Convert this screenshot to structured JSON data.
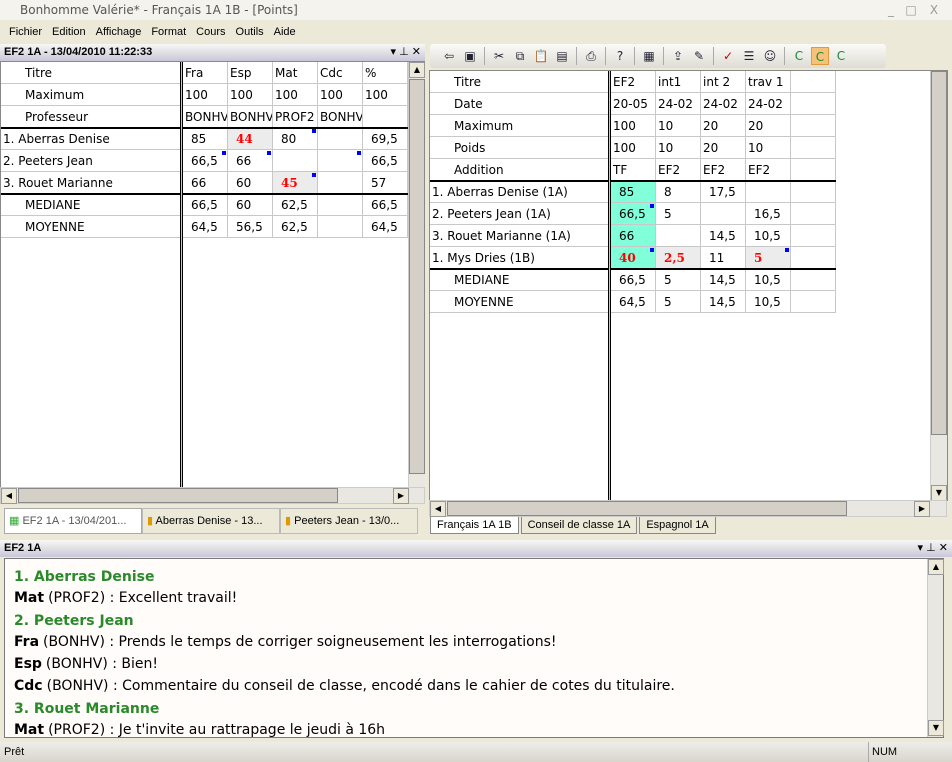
{
  "window": {
    "title": "Bonhomme Valérie* - Français 1A 1B - [Points]",
    "minimize": "_",
    "maximize": "□",
    "close": "X"
  },
  "menu": [
    "Fichier",
    "Edition",
    "Affichage",
    "Format",
    "Cours",
    "Outils",
    "Aide"
  ],
  "left_pane": {
    "title": "EF2 1A  - 13/04/2010 11:22:33",
    "header_rows": [
      "Titre",
      "Maximum",
      "Professeur"
    ],
    "student_rows": [
      "1. Aberras Denise",
      "2. Peeters Jean",
      "3. Rouet Marianne"
    ],
    "stat_rows": [
      "MEDIANE",
      "MOYENNE"
    ],
    "columns": [
      {
        "cells": [
          "Fra",
          "100",
          "BONHV"
        ],
        "students": [
          {
            "v": "85"
          },
          {
            "v": "66,5",
            "note": true
          },
          {
            "v": "66"
          }
        ],
        "stats": [
          "66,5",
          "64,5"
        ]
      },
      {
        "cells": [
          "Esp",
          "100",
          "BONHV"
        ],
        "students": [
          {
            "v": "44",
            "flag": true
          },
          {
            "v": "66",
            "note": true
          },
          {
            "v": "60"
          }
        ],
        "stats": [
          "60",
          "56,5"
        ]
      },
      {
        "cells": [
          "Mat",
          "100",
          "PROF2"
        ],
        "students": [
          {
            "v": "80",
            "note": true
          },
          {
            "v": ""
          },
          {
            "v": "45",
            "flag": true,
            "note": true
          }
        ],
        "stats": [
          "62,5",
          "62,5"
        ]
      },
      {
        "cells": [
          "Cdc",
          "100",
          "BONHV"
        ],
        "students": [
          {
            "v": ""
          },
          {
            "v": "",
            "note": true
          },
          {
            "v": ""
          }
        ],
        "stats": [
          "",
          ""
        ]
      },
      {
        "cells": [
          "%",
          "100",
          ""
        ],
        "students": [
          {
            "v": "69,5"
          },
          {
            "v": "66,5"
          },
          {
            "v": "57"
          }
        ],
        "stats": [
          "66,5",
          "64,5"
        ]
      }
    ],
    "tabs": [
      "EF2 1A  - 13/04/201...",
      "Aberras Denise   - 13...",
      "Peeters Jean   - 13/0..."
    ]
  },
  "right_pane": {
    "toolbar": [
      "exit-icon",
      "save-icon",
      "cut-icon",
      "copy-icon",
      "paste-icon",
      "paste-special-icon",
      "print-icon",
      "help-icon",
      "calendar-icon",
      "export-icon",
      "brush-icon",
      "check-icon",
      "list-icon",
      "student-icon",
      "column-c-icon",
      "column-c-selected-icon",
      "column-c-alt-icon"
    ],
    "header_rows": [
      "Titre",
      "Date",
      "Maximum",
      "Poids",
      "Addition"
    ],
    "student_rows": [
      "1. Aberras Denise (1A)",
      "2. Peeters Jean (1A)",
      "3. Rouet Marianne (1A)",
      "1. Mys Dries (1B)"
    ],
    "stat_rows": [
      "MEDIANE",
      "MOYENNE"
    ],
    "columns": [
      {
        "cells": [
          "EF2",
          "20-05",
          "100",
          "100",
          "TF"
        ],
        "students": [
          {
            "v": "85",
            "cyan": true
          },
          {
            "v": "66,5",
            "cyan": true,
            "note": true
          },
          {
            "v": "66",
            "cyan": true
          },
          {
            "v": "40",
            "cyan": true,
            "flag": true,
            "note": true
          }
        ],
        "stats": [
          "66,5",
          "64,5"
        ]
      },
      {
        "cells": [
          "int1",
          "24-02",
          "10",
          "10",
          "EF2"
        ],
        "students": [
          {
            "v": "8"
          },
          {
            "v": "5"
          },
          {
            "v": ""
          },
          {
            "v": "2,5",
            "flag": true
          }
        ],
        "stats": [
          "5",
          "5"
        ]
      },
      {
        "cells": [
          "int 2",
          "24-02",
          "20",
          "20",
          "EF2"
        ],
        "students": [
          {
            "v": "17,5"
          },
          {
            "v": ""
          },
          {
            "v": "14,5"
          },
          {
            "v": "11"
          }
        ],
        "stats": [
          "14,5",
          "14,5"
        ]
      },
      {
        "cells": [
          "trav 1",
          "24-02",
          "20",
          "10",
          "EF2"
        ],
        "students": [
          {
            "v": ""
          },
          {
            "v": "16,5"
          },
          {
            "v": "10,5"
          },
          {
            "v": "5",
            "flag": true,
            "note": true
          }
        ],
        "stats": [
          "10,5",
          "10,5"
        ]
      },
      {
        "cells": [
          "",
          "",
          "",
          "",
          ""
        ],
        "students": [
          {
            "v": ""
          },
          {
            "v": ""
          },
          {
            "v": ""
          },
          {
            "v": ""
          }
        ],
        "stats": [
          "",
          ""
        ]
      }
    ],
    "tabs": [
      "Français 1A 1B",
      "Conseil de classe 1A",
      "Espagnol 1A"
    ]
  },
  "comments_pane": {
    "title": "EF2 1A",
    "groups": [
      {
        "student": "1. Aberras Denise",
        "lines": [
          {
            "course": "Mat",
            "prof": "(PROF2)",
            "text": " : Excellent travail!"
          }
        ]
      },
      {
        "student": "2. Peeters Jean",
        "lines": [
          {
            "course": "Fra",
            "prof": "(BONHV)",
            "text": " : Prends le temps de corriger soigneusement les interrogations!"
          },
          {
            "course": "Esp",
            "prof": "(BONHV)",
            "text": " : Bien!"
          },
          {
            "course": "Cdc",
            "prof": "(BONHV)",
            "text": " : Commentaire du conseil de classe, encodé dans le cahier de cotes du titulaire."
          }
        ]
      },
      {
        "student": "3. Rouet Marianne",
        "lines": [
          {
            "course": "Mat",
            "prof": "(PROF2)",
            "text": " : Je t'invite au rattrapage le jeudi à 16h"
          }
        ]
      }
    ]
  },
  "status": {
    "text": "Prêt",
    "num": "NUM"
  },
  "colors": {
    "flag": "#ff0000",
    "highlight": "#80ffd8",
    "note_marker": "#0000ff",
    "student_name": "#2a8a2a"
  }
}
